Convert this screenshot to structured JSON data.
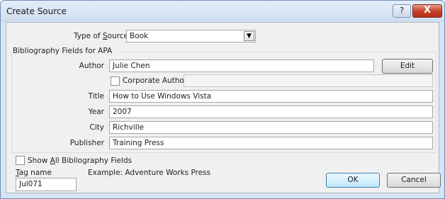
{
  "window": {
    "title": "Create Source",
    "help_glyph": "?",
    "close_glyph": "X"
  },
  "type_of_source": {
    "label_pre": "Type of ",
    "label_u": "S",
    "label_post": "ource",
    "value": "Book"
  },
  "group": {
    "label": "Bibliography Fields for APA"
  },
  "fields": {
    "author": {
      "label": "Author",
      "value": "Julie Chen"
    },
    "corporate_author": {
      "label": "Corporate Author",
      "checked": false,
      "value": ""
    },
    "title": {
      "label": "Title",
      "value": "How to Use Windows Vista"
    },
    "year": {
      "label": "Year",
      "value": "2007"
    },
    "city": {
      "label": "City",
      "value": "Richville"
    },
    "publisher": {
      "label": "Publisher",
      "value": "Training Press"
    }
  },
  "buttons": {
    "edit": "Edit",
    "ok": "OK",
    "cancel": "Cancel"
  },
  "show_all": {
    "label_pre": "Show ",
    "label_u": "A",
    "label_post": "ll Bibliography Fields",
    "checked": false
  },
  "tag": {
    "label_u": "T",
    "label_post": "ag name",
    "example": "Example: Adventure Works Press",
    "value": "Jul071"
  },
  "colors": {
    "titlebar": "#dbe7f4",
    "client_bg": "#f0f0f0",
    "close_red": "#c63d23"
  }
}
